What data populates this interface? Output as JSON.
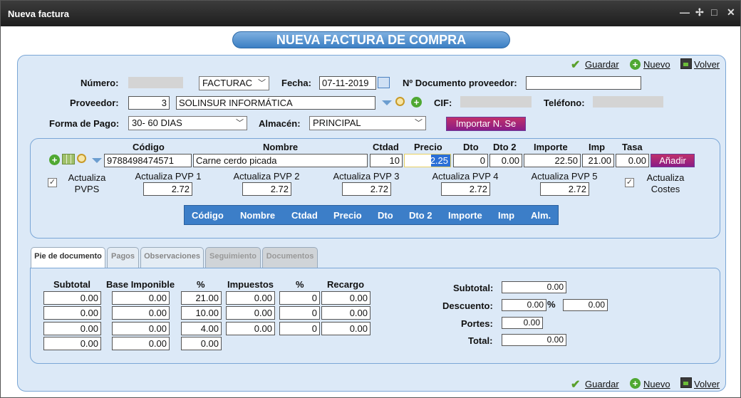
{
  "window": {
    "title": "Nueva factura",
    "controls": [
      "—",
      "✢",
      "□",
      "✕"
    ]
  },
  "banner": "NUEVA FACTURA DE COMPRA",
  "actions": {
    "guardar": "Guardar",
    "nuevo": "Nuevo",
    "volver": "Volver"
  },
  "header": {
    "numero_label": "Número:",
    "serie_value": "FACTURAC",
    "fecha_label": "Fecha:",
    "fecha_value": "07-11-2019",
    "doc_prov_label": "Nº Documento proveedor:",
    "doc_prov_value": "",
    "proveedor_label": "Proveedor:",
    "proveedor_code": "3",
    "proveedor_name": "SOLINSUR INFORMÁTICA",
    "cif_label": "CIF:",
    "telefono_label": "Teléfono:",
    "forma_pago_label": "Forma de Pago:",
    "forma_pago_value": "30- 60 DIAS",
    "almacen_label": "Almacén:",
    "almacen_value": "PRINCIPAL",
    "importar_label": "Importar N. Se"
  },
  "line": {
    "headers": {
      "codigo": "Código",
      "nombre": "Nombre",
      "ctdad": "Ctdad",
      "precio": "Precio",
      "dto": "Dto",
      "dto2": "Dto 2",
      "importe": "Importe",
      "imp": "Imp",
      "tasa": "Tasa"
    },
    "values": {
      "codigo": "9788498474571",
      "nombre": "Carne cerdo picada",
      "ctdad": "10",
      "precio": "2.25",
      "dto": "0",
      "dto2": "0.00",
      "importe": "22.50",
      "imp": "21.00",
      "tasa": "0.00"
    },
    "anadir": "Añadir",
    "actualiza_pvps": "Actualiza PVPS",
    "actualiza_costes": "Actualiza Costes",
    "pvp_labels": [
      "Actualiza PVP 1",
      "Actualiza PVP 2",
      "Actualiza PVP 3",
      "Actualiza PVP 4",
      "Actualiza PVP 5"
    ],
    "pvp_values": [
      "2.72",
      "2.72",
      "2.72",
      "2.72",
      "2.72"
    ]
  },
  "grid_headers": [
    "Código",
    "Nombre",
    "Ctdad",
    "Precio",
    "Dto",
    "Dto 2",
    "Importe",
    "Imp",
    "Alm."
  ],
  "tabs": [
    "Pie de documento",
    "Pagos",
    "Observaciones",
    "Seguimiento",
    "Documentos"
  ],
  "footer": {
    "headers": [
      "Subtotal",
      "Base Imponible",
      "%",
      "Impuestos",
      "%",
      "Recargo"
    ],
    "rows": [
      [
        "0.00",
        "0.00",
        "21.00",
        "0.00",
        "0",
        "0.00"
      ],
      [
        "0.00",
        "0.00",
        "10.00",
        "0.00",
        "0",
        "0.00"
      ],
      [
        "0.00",
        "0.00",
        "4.00",
        "0.00",
        "0",
        "0.00"
      ],
      [
        "0.00",
        "0.00",
        "0.00",
        "",
        "",
        ""
      ]
    ],
    "subtotal_label": "Subtotal:",
    "subtotal_value": "0.00",
    "descuento_label": "Descuento:",
    "descuento_pct": "0.00",
    "descuento_pct_sign": "%",
    "descuento_value": "0.00",
    "portes_label": "Portes:",
    "portes_value": "0.00",
    "total_label": "Total:",
    "total_value": "0.00"
  }
}
